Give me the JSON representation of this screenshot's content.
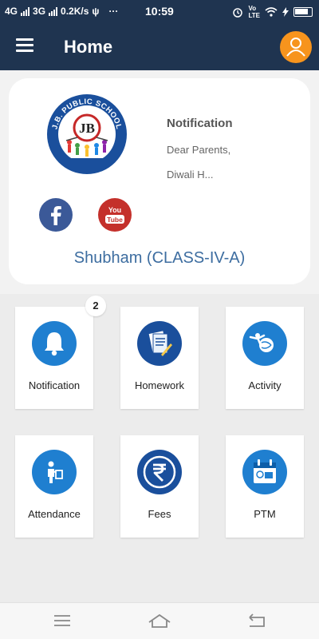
{
  "status_bar": {
    "network1": "4G",
    "network2": "3G",
    "speed": "0.2K/s",
    "dots": "···",
    "time": "10:59",
    "volte": "Vo",
    "lte": "LTE"
  },
  "app_bar": {
    "title": "Home",
    "menu_icon": "hamburger-menu-icon",
    "profile_icon": "user-icon",
    "profile_color": "#f7941d"
  },
  "profile_card": {
    "school_logo_text": "J.B. PUBLIC SCHOOL",
    "school_logo_monogram": "JB",
    "facebook_icon": "facebook-icon",
    "youtube_label_1": "You",
    "youtube_label_2": "Tube",
    "notification": {
      "title": "Notification",
      "line1": "Dear Parents,",
      "line2": "Diwali H..."
    },
    "student_name": "Shubham (CLASS-IV-A)"
  },
  "tiles": [
    {
      "label": "Notification",
      "icon": "bell-icon",
      "badge": "2"
    },
    {
      "label": "Homework",
      "icon": "homework-icon"
    },
    {
      "label": "Activity",
      "icon": "activity-icon"
    },
    {
      "label": "Attendance",
      "icon": "attendance-icon"
    },
    {
      "label": "Fees",
      "icon": "rupee-icon"
    },
    {
      "label": "PTM",
      "icon": "calendar-icon"
    }
  ],
  "colors": {
    "header": "#1f3450",
    "accent_blue": "#1f7fd0",
    "name_text": "#3d6da0",
    "background": "#ececec"
  }
}
